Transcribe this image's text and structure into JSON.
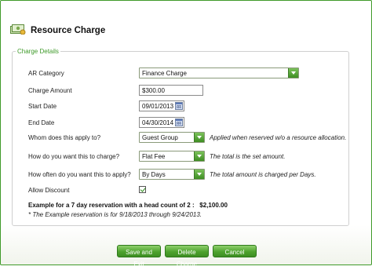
{
  "window": {
    "title": "Resource Charge",
    "title_icon": "money-icon"
  },
  "group": {
    "legend": "Charge Details"
  },
  "fields": {
    "ar_category": {
      "label": "AR Category",
      "value": "Finance Charge"
    },
    "charge_amount": {
      "label": "Charge Amount",
      "value": "$300.00"
    },
    "start_date": {
      "label": "Start Date",
      "value": "09/01/2013"
    },
    "end_date": {
      "label": "End Date",
      "value": "04/30/2014"
    },
    "applies_to": {
      "label": "Whom does this apply to?",
      "value": "Guest Group",
      "note": "Applied when reserved w/o a resource allocation."
    },
    "charge_type": {
      "label": "How do you want this to charge?",
      "value": "Flat Fee",
      "note": "The total is the set amount."
    },
    "frequency": {
      "label": "How often do you want this to apply?",
      "value": "By Days",
      "note": "The total amount is charged per Days."
    },
    "allow_discount": {
      "label": "Allow Discount",
      "checked": true
    }
  },
  "example": {
    "text": "Example for a 7 day reservation with a head count of 2 :",
    "amount": "$2,100.00",
    "note": "* The Example reservation is for 9/18/2013 through 9/24/2013."
  },
  "buttons": {
    "save_exit": "Save and Exit",
    "delete": "Delete Charge",
    "cancel": "Cancel"
  },
  "colors": {
    "accent": "#3f9a2a",
    "button": "#4ea32e"
  }
}
